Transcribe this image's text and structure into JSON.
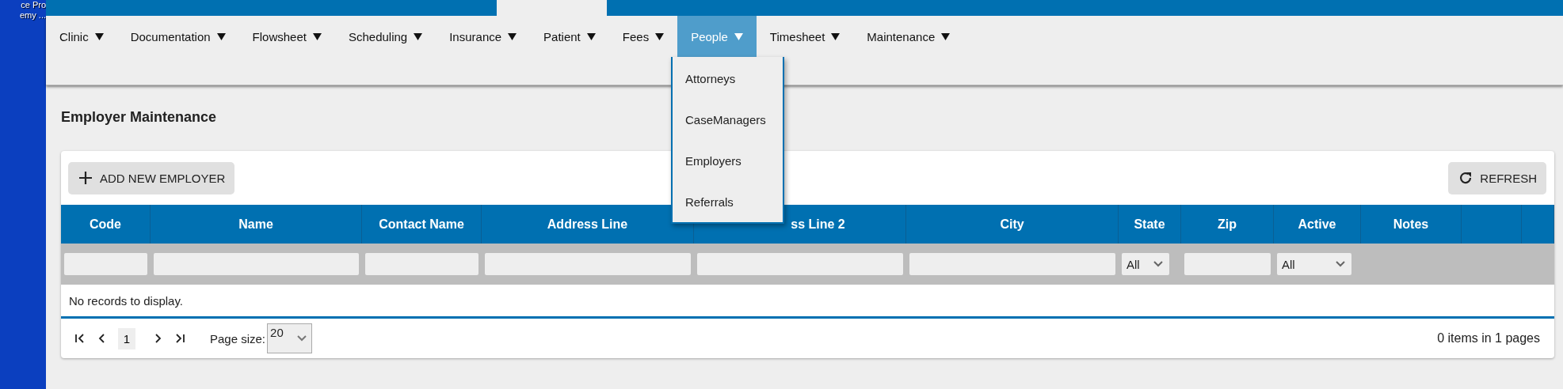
{
  "desktop": {
    "labels": [
      "ce Pro",
      "emy ..."
    ]
  },
  "menu": [
    {
      "label": "Clinic",
      "selected": false
    },
    {
      "label": "Documentation",
      "selected": false
    },
    {
      "label": "Flowsheet",
      "selected": false
    },
    {
      "label": "Scheduling",
      "selected": false
    },
    {
      "label": "Insurance",
      "selected": false
    },
    {
      "label": "Patient",
      "selected": false
    },
    {
      "label": "Fees",
      "selected": false
    },
    {
      "label": "People",
      "selected": true
    },
    {
      "label": "Timesheet",
      "selected": false
    },
    {
      "label": "Maintenance",
      "selected": false
    }
  ],
  "dropdown": {
    "items": [
      "Attorneys",
      "CaseManagers",
      "Employers",
      "Referrals"
    ]
  },
  "page_title": "Employer Maintenance",
  "toolbar": {
    "add_button": "ADD NEW EMPLOYER",
    "refresh_button": "REFRESH"
  },
  "table": {
    "columns": [
      "Code",
      "Name",
      "Contact Name",
      "Address Line",
      "ss Line 2",
      "City",
      "State",
      "Zip",
      "Active",
      "Notes"
    ],
    "filters": [
      {
        "kind": "text"
      },
      {
        "kind": "text"
      },
      {
        "kind": "text"
      },
      {
        "kind": "text"
      },
      {
        "kind": "text"
      },
      {
        "kind": "text"
      },
      {
        "kind": "select",
        "value": "All"
      },
      {
        "kind": "text"
      },
      {
        "kind": "select",
        "value": "All"
      }
    ],
    "empty_message": "No records to display."
  },
  "pager": {
    "current_page": "1",
    "page_size_label": "Page size:",
    "page_size": "20",
    "summary": "0 items in 1 pages"
  }
}
